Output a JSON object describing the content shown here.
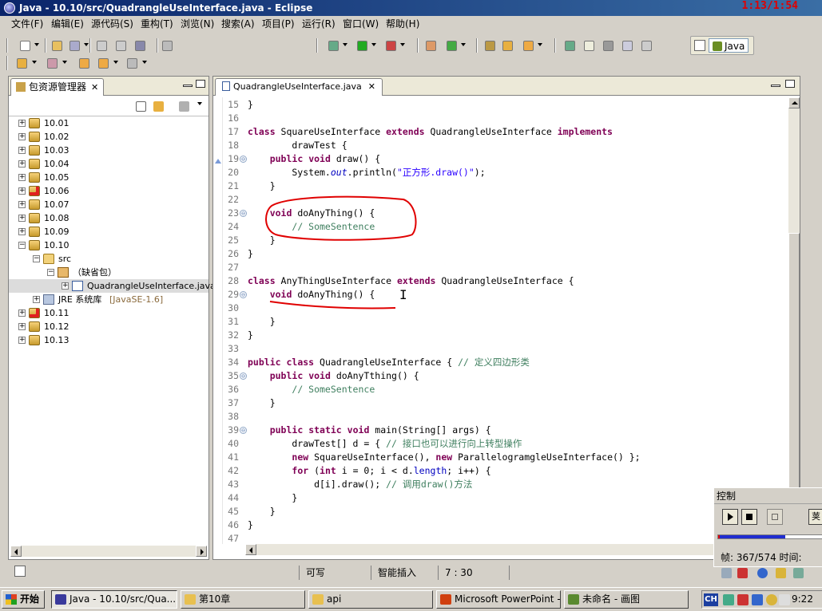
{
  "window": {
    "title": "Java - 10.10/src/QuadrangleUseInterface.java - Eclipse",
    "recording_timer": "1:13/1:54"
  },
  "menu": [
    "文件(F)",
    "编辑(E)",
    "源代码(S)",
    "重构(T)",
    "浏览(N)",
    "搜索(A)",
    "项目(P)",
    "运行(R)",
    "窗口(W)",
    "帮助(H)"
  ],
  "perspective": {
    "label": "Java"
  },
  "package_explorer": {
    "tab_label": "包资源管理器",
    "close_glyph": "✕",
    "projects_top": [
      {
        "label": "10.01",
        "error": false
      },
      {
        "label": "10.02",
        "error": false
      },
      {
        "label": "10.03",
        "error": false
      },
      {
        "label": "10.04",
        "error": false
      },
      {
        "label": "10.05",
        "error": false
      },
      {
        "label": "10.06",
        "error": true
      },
      {
        "label": "10.07",
        "error": false
      },
      {
        "label": "10.08",
        "error": false
      },
      {
        "label": "10.09",
        "error": false
      },
      {
        "label": "10.10",
        "error": false
      }
    ],
    "src_label": "src",
    "default_package_label": "（缺省包）",
    "file_label": "QuadrangleUseInterface.java",
    "jre_label": "JRE 系统库",
    "jre_version": "[JavaSE-1.6]",
    "projects_bottom": [
      {
        "label": "10.11",
        "error": true
      },
      {
        "label": "10.12",
        "error": false
      },
      {
        "label": "10.13",
        "error": false
      }
    ],
    "expand_glyph": "+",
    "collapse_glyph": "−"
  },
  "editor": {
    "tab_label": "QuadrangleUseInterface.java",
    "close_glyph": "✕",
    "lines": [
      {
        "n": "15",
        "fold": "",
        "tokens": [
          {
            "t": "}",
            "c": ""
          }
        ]
      },
      {
        "n": "16",
        "fold": "",
        "tokens": []
      },
      {
        "n": "17",
        "fold": "",
        "tokens": [
          {
            "t": "class",
            "c": "kw"
          },
          {
            "t": " SquareUseInterface ",
            "c": ""
          },
          {
            "t": "extends",
            "c": "kw"
          },
          {
            "t": " QuadrangleUseInterface ",
            "c": ""
          },
          {
            "t": "implements",
            "c": "kw"
          }
        ]
      },
      {
        "n": "18",
        "fold": "",
        "tokens": [
          {
            "t": "        drawTest {",
            "c": ""
          }
        ]
      },
      {
        "n": "19",
        "fold": "⊖",
        "marker": true,
        "tokens": [
          {
            "t": "    ",
            "c": ""
          },
          {
            "t": "public",
            "c": "kw"
          },
          {
            "t": " ",
            "c": ""
          },
          {
            "t": "void",
            "c": "kw"
          },
          {
            "t": " draw() {",
            "c": ""
          }
        ]
      },
      {
        "n": "20",
        "fold": "",
        "tokens": [
          {
            "t": "        System.",
            "c": ""
          },
          {
            "t": "out",
            "c": "it"
          },
          {
            "t": ".println(",
            "c": ""
          },
          {
            "t": "\"正方形.draw()\"",
            "c": "st"
          },
          {
            "t": ");",
            "c": ""
          }
        ]
      },
      {
        "n": "21",
        "fold": "",
        "tokens": [
          {
            "t": "    }",
            "c": ""
          }
        ]
      },
      {
        "n": "22",
        "fold": "",
        "tokens": []
      },
      {
        "n": "23",
        "fold": "⊖",
        "tokens": [
          {
            "t": "    ",
            "c": ""
          },
          {
            "t": "void",
            "c": "kw"
          },
          {
            "t": " doAnyThing() {",
            "c": ""
          }
        ]
      },
      {
        "n": "24",
        "fold": "",
        "tokens": [
          {
            "t": "        ",
            "c": ""
          },
          {
            "t": "// SomeSentence",
            "c": "cm"
          }
        ]
      },
      {
        "n": "25",
        "fold": "",
        "tokens": [
          {
            "t": "    }",
            "c": ""
          }
        ]
      },
      {
        "n": "26",
        "fold": "",
        "tokens": [
          {
            "t": "}",
            "c": ""
          }
        ]
      },
      {
        "n": "27",
        "fold": "",
        "tokens": []
      },
      {
        "n": "28",
        "fold": "",
        "tokens": [
          {
            "t": "class",
            "c": "kw"
          },
          {
            "t": " AnyThingUseInterface ",
            "c": ""
          },
          {
            "t": "extends",
            "c": "kw"
          },
          {
            "t": " QuadrangleUseInterface {",
            "c": ""
          }
        ]
      },
      {
        "n": "29",
        "fold": "⊖",
        "tokens": [
          {
            "t": "    ",
            "c": ""
          },
          {
            "t": "void",
            "c": "kw"
          },
          {
            "t": " doAnyThing() {",
            "c": ""
          }
        ]
      },
      {
        "n": "30",
        "fold": "",
        "tokens": []
      },
      {
        "n": "31",
        "fold": "",
        "tokens": [
          {
            "t": "    }",
            "c": ""
          }
        ]
      },
      {
        "n": "32",
        "fold": "",
        "tokens": [
          {
            "t": "}",
            "c": ""
          }
        ]
      },
      {
        "n": "33",
        "fold": "",
        "tokens": []
      },
      {
        "n": "34",
        "fold": "",
        "tokens": [
          {
            "t": "public",
            "c": "kw"
          },
          {
            "t": " ",
            "c": ""
          },
          {
            "t": "class",
            "c": "kw"
          },
          {
            "t": " QuadrangleUseInterface { ",
            "c": ""
          },
          {
            "t": "// 定义四边形类",
            "c": "cm"
          }
        ]
      },
      {
        "n": "35",
        "fold": "⊖",
        "tokens": [
          {
            "t": "    ",
            "c": ""
          },
          {
            "t": "public",
            "c": "kw"
          },
          {
            "t": " ",
            "c": ""
          },
          {
            "t": "void",
            "c": "kw"
          },
          {
            "t": " doAnyTthing() {",
            "c": ""
          }
        ]
      },
      {
        "n": "36",
        "fold": "",
        "tokens": [
          {
            "t": "        ",
            "c": ""
          },
          {
            "t": "// SomeSentence",
            "c": "cm"
          }
        ]
      },
      {
        "n": "37",
        "fold": "",
        "tokens": [
          {
            "t": "    }",
            "c": ""
          }
        ]
      },
      {
        "n": "38",
        "fold": "",
        "tokens": []
      },
      {
        "n": "39",
        "fold": "⊖",
        "tokens": [
          {
            "t": "    ",
            "c": ""
          },
          {
            "t": "public",
            "c": "kw"
          },
          {
            "t": " ",
            "c": ""
          },
          {
            "t": "static",
            "c": "kw"
          },
          {
            "t": " ",
            "c": ""
          },
          {
            "t": "void",
            "c": "kw"
          },
          {
            "t": " main(String[] args) {",
            "c": ""
          }
        ]
      },
      {
        "n": "40",
        "fold": "",
        "tokens": [
          {
            "t": "        drawTest[] d = { ",
            "c": ""
          },
          {
            "t": "// 接口也可以进行向上转型操作",
            "c": "cm"
          }
        ]
      },
      {
        "n": "41",
        "fold": "",
        "tokens": [
          {
            "t": "        ",
            "c": ""
          },
          {
            "t": "new",
            "c": "kw"
          },
          {
            "t": " SquareUseInterface(), ",
            "c": ""
          },
          {
            "t": "new",
            "c": "kw"
          },
          {
            "t": " ParallelogramgleUseInterface() };",
            "c": ""
          }
        ]
      },
      {
        "n": "42",
        "fold": "",
        "tokens": [
          {
            "t": "        ",
            "c": ""
          },
          {
            "t": "for",
            "c": "kw"
          },
          {
            "t": " (",
            "c": ""
          },
          {
            "t": "int",
            "c": "kw"
          },
          {
            "t": " i = 0; i < d.",
            "c": ""
          },
          {
            "t": "length",
            "c": "fd"
          },
          {
            "t": "; i++) {",
            "c": ""
          }
        ]
      },
      {
        "n": "43",
        "fold": "",
        "tokens": [
          {
            "t": "            d[i].draw(); ",
            "c": ""
          },
          {
            "t": "// 调用draw()方法",
            "c": "cm"
          }
        ]
      },
      {
        "n": "44",
        "fold": "",
        "tokens": [
          {
            "t": "        }",
            "c": ""
          }
        ]
      },
      {
        "n": "45",
        "fold": "",
        "tokens": [
          {
            "t": "    }",
            "c": ""
          }
        ]
      },
      {
        "n": "46",
        "fold": "",
        "tokens": [
          {
            "t": "}",
            "c": ""
          }
        ]
      },
      {
        "n": "47",
        "fold": "",
        "tokens": []
      }
    ]
  },
  "status": {
    "writable": "可写",
    "insert_mode": "智能插入",
    "position": "7 : 30"
  },
  "control_panel": {
    "title": "控制",
    "extra_button_glyph": "荚",
    "progress": 0.64,
    "frame_text": "帧: 367/574 时间:"
  },
  "taskbar": {
    "start_label": "开始",
    "tasks": [
      {
        "label": "Java - 10.10/src/Qua...",
        "active": true,
        "icon_color": "#3a3a9c"
      },
      {
        "label": "第10章",
        "active": false,
        "icon_color": "#e8c050"
      },
      {
        "label": "api",
        "active": false,
        "icon_color": "#e8c050"
      },
      {
        "label": "Microsoft PowerPoint - [...",
        "active": false,
        "icon_color": "#d04010"
      },
      {
        "label": "未命名 - 画图",
        "active": false,
        "icon_color": "#5a8a30"
      }
    ],
    "language_indicator": "CH",
    "clock": "9:22"
  },
  "colors": {
    "keyword": "#7f0055",
    "comment": "#3f7f5f",
    "string": "#2a00ff",
    "annotation_red": "#e00000"
  }
}
